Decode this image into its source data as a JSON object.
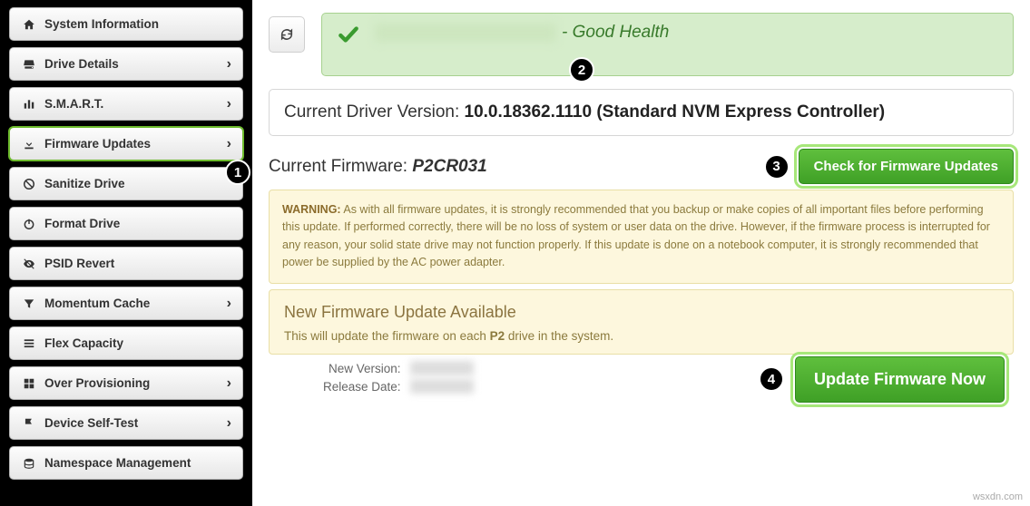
{
  "sidebar": {
    "items": [
      {
        "label": "System Information",
        "chev": false
      },
      {
        "label": "Drive Details",
        "chev": true
      },
      {
        "label": "S.M.A.R.T.",
        "chev": true
      },
      {
        "label": "Firmware Updates",
        "chev": true
      },
      {
        "label": "Sanitize Drive",
        "chev": false
      },
      {
        "label": "Format Drive",
        "chev": false
      },
      {
        "label": "PSID Revert",
        "chev": false
      },
      {
        "label": "Momentum Cache",
        "chev": true
      },
      {
        "label": "Flex Capacity",
        "chev": false
      },
      {
        "label": "Over Provisioning",
        "chev": true
      },
      {
        "label": "Device Self-Test",
        "chev": true
      },
      {
        "label": "Namespace Management",
        "chev": false
      }
    ]
  },
  "health": {
    "status": "- Good Health"
  },
  "driver": {
    "prefix": "Current Driver Version: ",
    "value": "10.0.18362.1110 (Standard NVM Express Controller)"
  },
  "firmware": {
    "prefix": "Current Firmware: ",
    "value": "P2CR031",
    "check_btn": "Check for Firmware Updates"
  },
  "warning": {
    "label": "WARNING:",
    "text": "As with all firmware updates, it is strongly recommended that you backup or make copies of all important files before performing this update. If performed correctly, there will be no loss of system or user data on the drive. However, if the firmware process is interrupted for any reason, your solid state drive may not function properly. If this update is done on a notebook computer, it is strongly recommended that power be supplied by the AC power adapter."
  },
  "update": {
    "title": "New Firmware Update Available",
    "subtext_a": "This will update the firmware on each ",
    "subtext_b": "P2",
    "subtext_c": " drive in the system.",
    "new_version_label": "New Version:",
    "release_date_label": "Release Date:",
    "btn": "Update Firmware Now"
  },
  "callouts": {
    "c1": "1",
    "c2": "2",
    "c3": "3",
    "c4": "4"
  },
  "watermark": "wsxdn.com"
}
